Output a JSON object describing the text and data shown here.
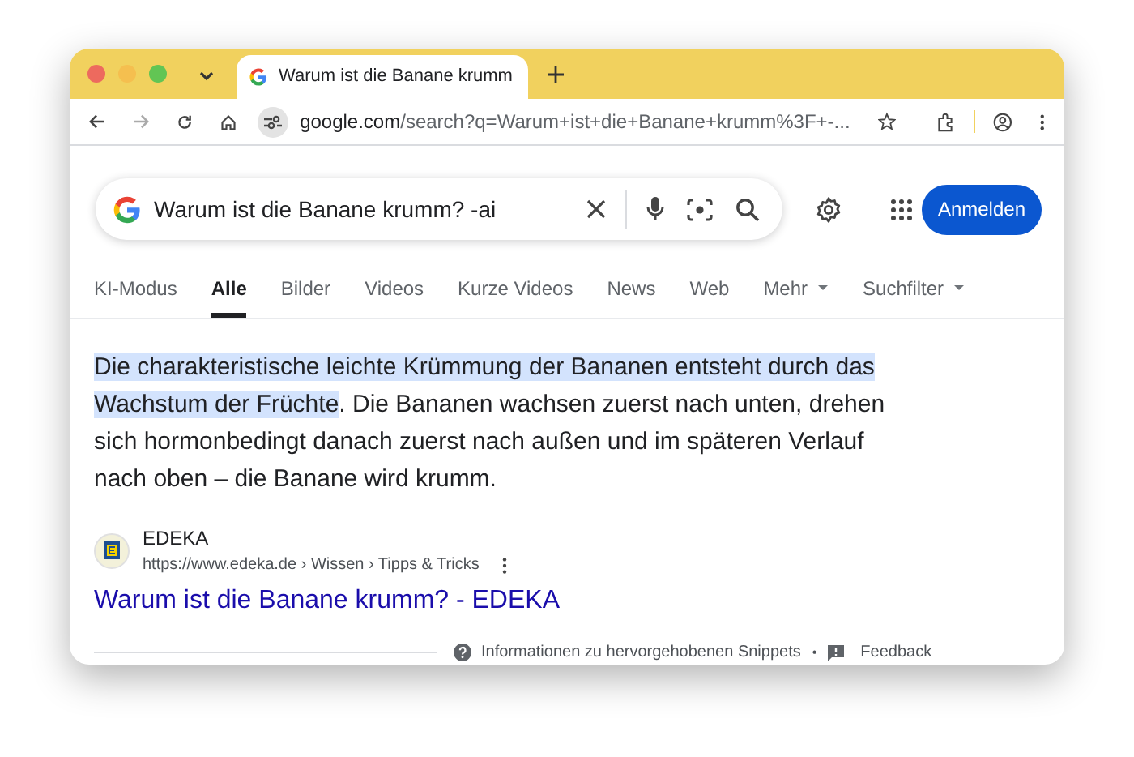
{
  "browser": {
    "tab": {
      "title": "Warum ist die Banane krumm"
    },
    "address": {
      "domain": "google.com",
      "path": "/search?q=Warum+ist+die+Banane+krumm%3F+-..."
    }
  },
  "search": {
    "value": "Warum ist die Banane krumm? -ai",
    "sign_in": "Anmelden"
  },
  "nav_tabs": [
    {
      "label": "KI-Modus",
      "selected": false,
      "dropdown": false
    },
    {
      "label": "Alle",
      "selected": true,
      "dropdown": false
    },
    {
      "label": "Bilder",
      "selected": false,
      "dropdown": false
    },
    {
      "label": "Videos",
      "selected": false,
      "dropdown": false
    },
    {
      "label": "Kurze Videos",
      "selected": false,
      "dropdown": false
    },
    {
      "label": "News",
      "selected": false,
      "dropdown": false
    },
    {
      "label": "Web",
      "selected": false,
      "dropdown": false
    },
    {
      "label": "Mehr",
      "selected": false,
      "dropdown": true
    },
    {
      "label": "Suchfilter",
      "selected": false,
      "dropdown": true
    }
  ],
  "snippet": {
    "highlighted": "Die charakteristische leichte Krümmung der Bananen entsteht durch das Wachstum der Früchte",
    "text": ". Die Bananen wachsen zuerst nach unten, drehen sich hormonbedingt danach zuerst nach außen und im späteren Verlauf nach oben – die Banane wird krumm."
  },
  "result": {
    "site": "EDEKA",
    "breadcrumb": "https://www.edeka.de › Wissen › Tipps & Tricks",
    "title": "Warum ist die Banane krumm? - EDEKA"
  },
  "footer": {
    "info": "Informationen zu hervorgehobenen Snippets",
    "separator": "•",
    "feedback": "Feedback"
  }
}
